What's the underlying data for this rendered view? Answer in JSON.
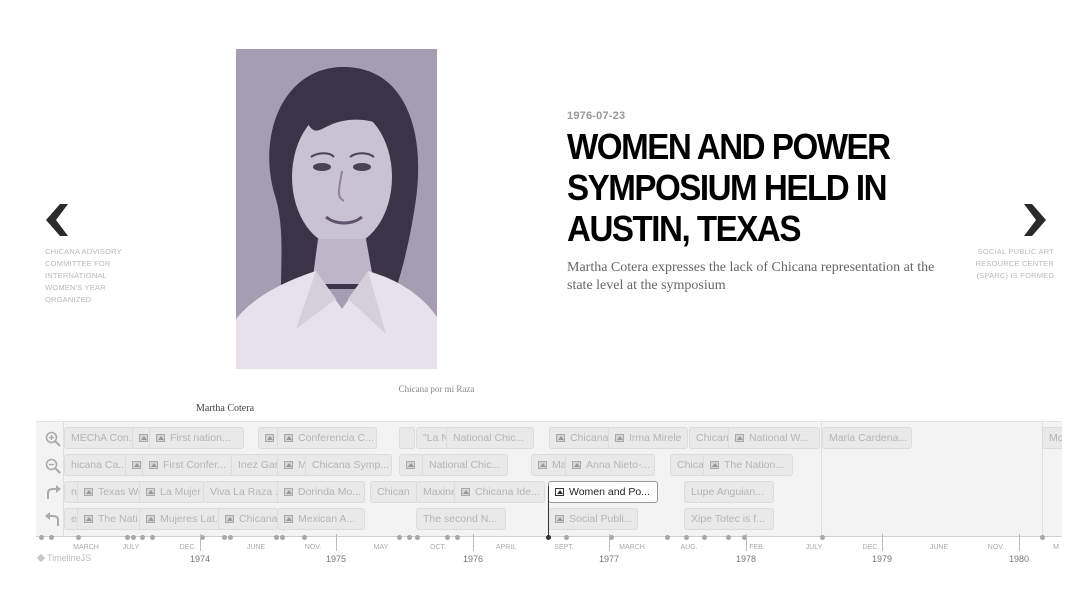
{
  "slide": {
    "date": "1976-07-23",
    "headline": "Women and Power Symposium Held in Austin, Texas",
    "text": "Martha Cotera expresses the lack of Chicana representation at the state level at the symposium",
    "media_credit": "Chicana por mi Raza",
    "media_caption": "Martha Cotera"
  },
  "nav": {
    "prev_title": "Chicana Advisory Committee for International Women's Year Organized",
    "next_title": "Social Public Art Resource Center (SPARC) is formed"
  },
  "icons": {
    "prev": "chevron-left-icon",
    "next": "chevron-right-icon",
    "zoom_in": "zoom-in-icon",
    "zoom_out": "zoom-out-icon",
    "undo": "undo-icon",
    "back": "back-icon"
  },
  "colors": {
    "photo_tint": "#9f97ae",
    "headline": "#000000",
    "timenav_bg": "#f3f3f3"
  },
  "markers": {
    "row1": [
      {
        "label": "MEChA Con...",
        "icon": false
      },
      {
        "label": "",
        "icon": true
      },
      {
        "label": "First nation...",
        "icon": true
      },
      {
        "label": "",
        "icon": true
      },
      {
        "label": "Conferencia C...",
        "icon": true
      },
      {
        "label": "",
        "icon": false
      },
      {
        "label": "\"La N",
        "icon": false
      },
      {
        "label": "National Chic...",
        "icon": false
      },
      {
        "label": "Chicana",
        "icon": true
      },
      {
        "label": "Irma Mirele",
        "icon": true
      },
      {
        "label": "Chicana",
        "icon": false
      },
      {
        "label": "National W...",
        "icon": true
      },
      {
        "label": "Maria Cardena...",
        "icon": false
      },
      {
        "label": "Mc",
        "icon": false
      }
    ],
    "row2": [
      {
        "label": "hicana Ca...",
        "icon": false
      },
      {
        "label": "",
        "icon": true
      },
      {
        "label": "First Confer...",
        "icon": true
      },
      {
        "label": "Inez Gar",
        "icon": false
      },
      {
        "label": "M",
        "icon": true
      },
      {
        "label": "Chicana Symp...",
        "icon": false
      },
      {
        "label": "",
        "icon": true
      },
      {
        "label": "National Chic...",
        "icon": false
      },
      {
        "label": "Ma",
        "icon": true
      },
      {
        "label": "Anna Nieto-...",
        "icon": true
      },
      {
        "label": "Chica",
        "icon": false
      },
      {
        "label": "The Nation...",
        "icon": true
      }
    ],
    "row3": [
      {
        "label": "ni",
        "icon": false
      },
      {
        "label": "Texas Wo",
        "icon": true
      },
      {
        "label": "La Mujer",
        "icon": true
      },
      {
        "label": "Viva La Raza ...",
        "icon": false
      },
      {
        "label": "Dorinda Mo...",
        "icon": true
      },
      {
        "label": "Chican",
        "icon": false
      },
      {
        "label": "Maxine",
        "icon": false
      },
      {
        "label": "Chicana Ide...",
        "icon": true
      },
      {
        "label": "Women and Po...",
        "icon": true,
        "active": true
      },
      {
        "label": "Lupe Anguian...",
        "icon": false
      }
    ],
    "row4": [
      {
        "label": "e",
        "icon": false
      },
      {
        "label": "The Nati",
        "icon": true
      },
      {
        "label": "Mujeres Lat...",
        "icon": true
      },
      {
        "label": "Chicana",
        "icon": true
      },
      {
        "label": "Mexican A...",
        "icon": true
      },
      {
        "label": "The second N...",
        "icon": false
      },
      {
        "label": "Social Publi...",
        "icon": true
      },
      {
        "label": "Xipe Totec is f...",
        "icon": false
      }
    ]
  },
  "axis": {
    "months": [
      "MARCH",
      "JULY",
      "DEC.",
      "JUNE",
      "NOV.",
      "MAY",
      "OCT.",
      "APRIL",
      "SEPT.",
      "MARCH",
      "AUG.",
      "FEB.",
      "JULY",
      "DEC.",
      "JUNE",
      "NOV.",
      "M"
    ],
    "years": [
      "1974",
      "1975",
      "1976",
      "1977",
      "1978",
      "1979",
      "1980"
    ]
  },
  "attribution": "TimelineJS"
}
